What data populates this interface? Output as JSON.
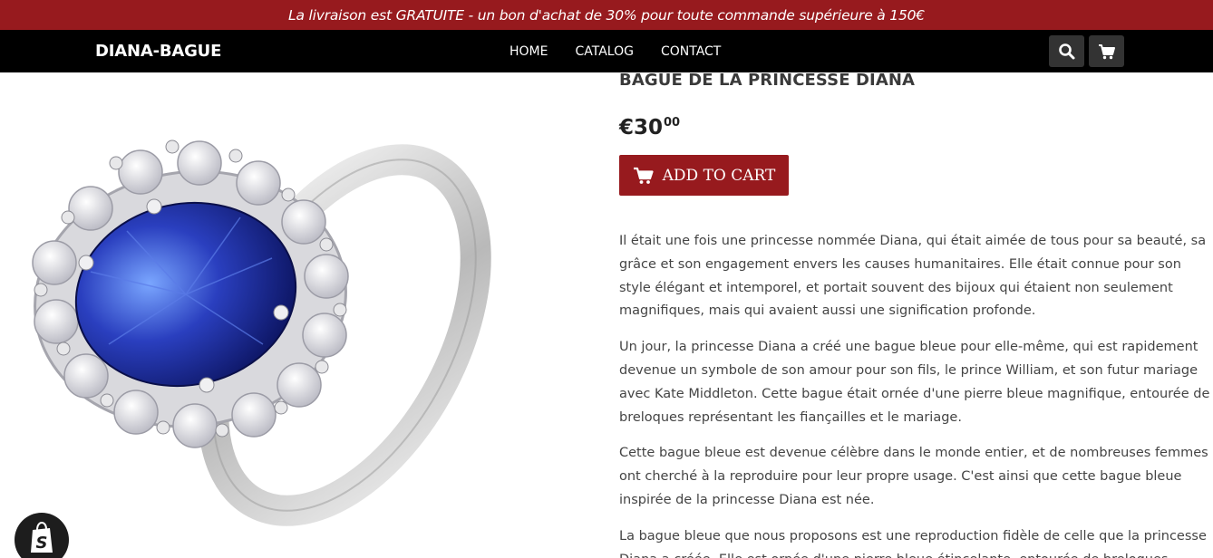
{
  "announcement": {
    "text": "La livraison est GRATUITE - un bon d'achat de 30% pour toute commande supérieure à 150€"
  },
  "header": {
    "logo": "DIANA-BAGUE",
    "nav": [
      {
        "label": "HOME"
      },
      {
        "label": "CATALOG"
      },
      {
        "label": "CONTACT"
      }
    ],
    "search_icon": "search-icon",
    "cart_icon": "cart-icon"
  },
  "product": {
    "title": "BAGUE DE LA PRINCESSE DIANA",
    "price_main": "€30",
    "price_cents": "00",
    "add_to_cart_label": "ADD TO CART",
    "description": [
      "Il était une fois une princesse nommée Diana, qui était aimée de tous pour sa beauté, sa grâce et son engagement envers les causes humanitaires. Elle était connue pour son style élégant et intemporel, et portait souvent des bijoux qui étaient non seulement magnifiques, mais qui avaient aussi une signification profonde.",
      "Un jour, la princesse Diana a créé une bague bleue pour elle-même, qui est rapidement devenue un symbole de son amour pour son fils, le prince William, et son futur mariage avec Kate Middleton. Cette bague était ornée d'une pierre bleue magnifique, entourée de breloques représentant les fiançailles et le mariage.",
      "Cette bague bleue est devenue célèbre dans le monde entier, et de nombreuses femmes ont cherché à la reproduire pour leur propre usage. C'est ainsi que cette bague bleue inspirée de la princesse Diana est née.",
      "La bague bleue que nous proposons est une reproduction fidèle de celle que la princesse Diana a créée. Elle est ornée d'une pierre bleue étincelante, entourée de breloques"
    ]
  },
  "colors": {
    "brand_red": "#971a1e",
    "header_black": "#000000",
    "sapphire": "#2a3fbf"
  }
}
